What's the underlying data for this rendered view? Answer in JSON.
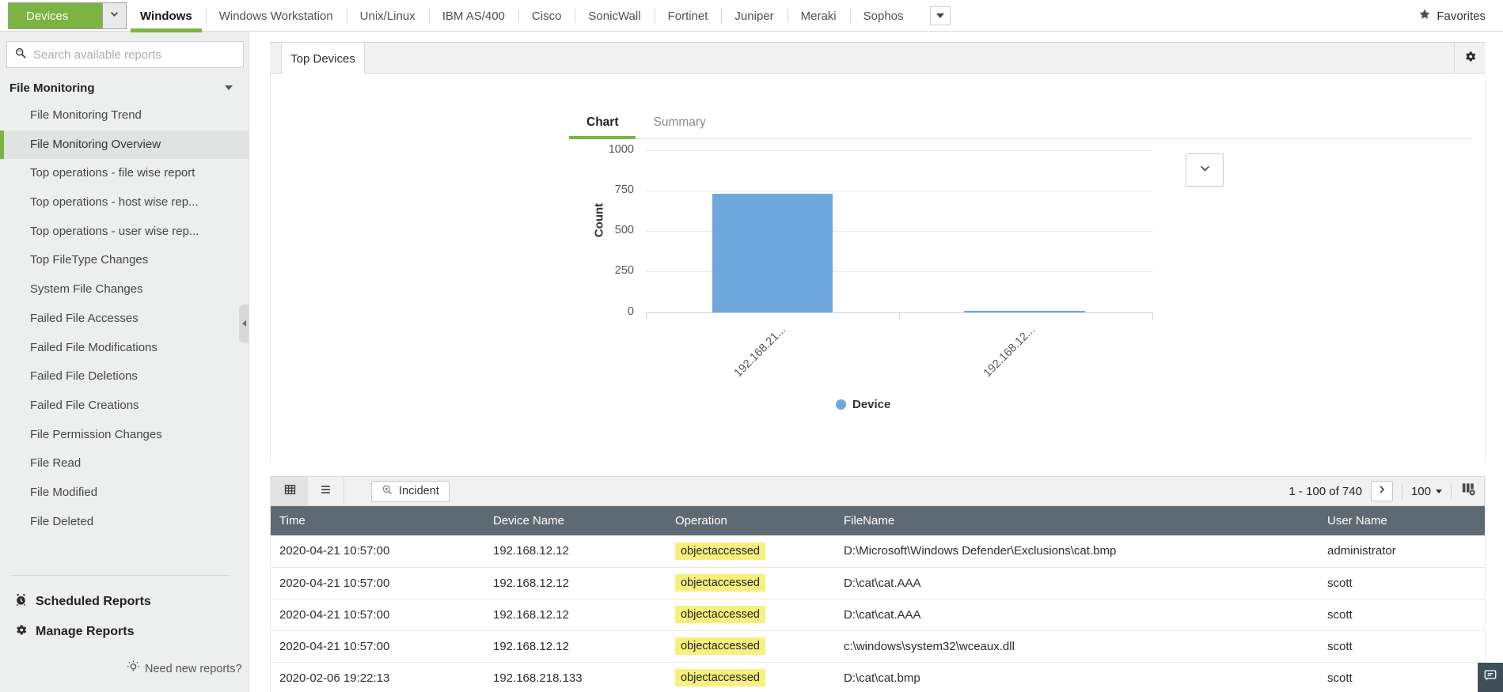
{
  "topbar": {
    "devices_button": "Devices",
    "tabs": [
      "Windows",
      "Windows Workstation",
      "Unix/Linux",
      "IBM AS/400",
      "Cisco",
      "SonicWall",
      "Fortinet",
      "Juniper",
      "Meraki",
      "Sophos"
    ],
    "active_tab": "Windows",
    "favorites_label": "Favorites"
  },
  "sidebar": {
    "search_placeholder": "Search available reports",
    "section_title": "File Monitoring",
    "items": [
      "File Monitoring Trend",
      "File Monitoring Overview",
      "Top operations - file wise report",
      "Top operations - host wise rep...",
      "Top operations - user wise rep...",
      "Top FileType Changes",
      "System File Changes",
      "Failed File Accesses",
      "Failed File Modifications",
      "Failed File Deletions",
      "Failed File Creations",
      "File Permission Changes",
      "File Read",
      "File Modified",
      "File Deleted"
    ],
    "selected_item": "File Monitoring Overview",
    "scheduled_reports_label": "Scheduled Reports",
    "manage_reports_label": "Manage Reports",
    "need_new_reports_label": "Need new reports?"
  },
  "panel": {
    "tab_label": "Top Devices",
    "view_tabs": {
      "chart": "Chart",
      "summary": "Summary"
    }
  },
  "chart_data": {
    "type": "bar",
    "title": "Top Devices",
    "categories": [
      "192.168.21...",
      "192.168.12..."
    ],
    "values": [
      730,
      10
    ],
    "series": [
      {
        "name": "Device",
        "values": [
          730,
          10
        ]
      }
    ],
    "xlabel": "",
    "ylabel": "Count",
    "ylim": [
      0,
      1000
    ],
    "yticks_top_to_bottom": [
      "1000",
      "750",
      "500",
      "250",
      "0"
    ],
    "legend": [
      "Device"
    ],
    "legend_position": "bottom",
    "grid": true,
    "bar_color": "#6fa8dc"
  },
  "table": {
    "toolbar": {
      "incident_label": "Incident",
      "pagination": "1 - 100 of 740",
      "page_size": "100"
    },
    "headers": [
      "Time",
      "Device Name",
      "Operation",
      "FileName",
      "User Name"
    ],
    "rows": [
      {
        "time": "2020-04-21 10:57:00",
        "device": "192.168.12.12",
        "operation": "objectaccessed",
        "file": "D:\\Microsoft\\Windows Defender\\Exclusions\\cat.bmp",
        "user": "administrator"
      },
      {
        "time": "2020-04-21 10:57:00",
        "device": "192.168.12.12",
        "operation": "objectaccessed",
        "file": "D:\\cat\\cat.AAA",
        "user": "scott"
      },
      {
        "time": "2020-04-21 10:57:00",
        "device": "192.168.12.12",
        "operation": "objectaccessed",
        "file": "D:\\cat\\cat.AAA",
        "user": "scott"
      },
      {
        "time": "2020-04-21 10:57:00",
        "device": "192.168.12.12",
        "operation": "objectaccessed",
        "file": "c:\\windows\\system32\\wceaux.dll",
        "user": "scott"
      },
      {
        "time": "2020-02-06 19:22:13",
        "device": "192.168.218.133",
        "operation": "objectaccessed",
        "file": "D:\\cat\\cat.bmp",
        "user": "scott"
      }
    ]
  },
  "colors": {
    "accent_green": "#7cb342",
    "bar_blue": "#6fa8dc",
    "table_header_bg": "#5e6a73",
    "operation_highlight": "#f8f07c"
  }
}
